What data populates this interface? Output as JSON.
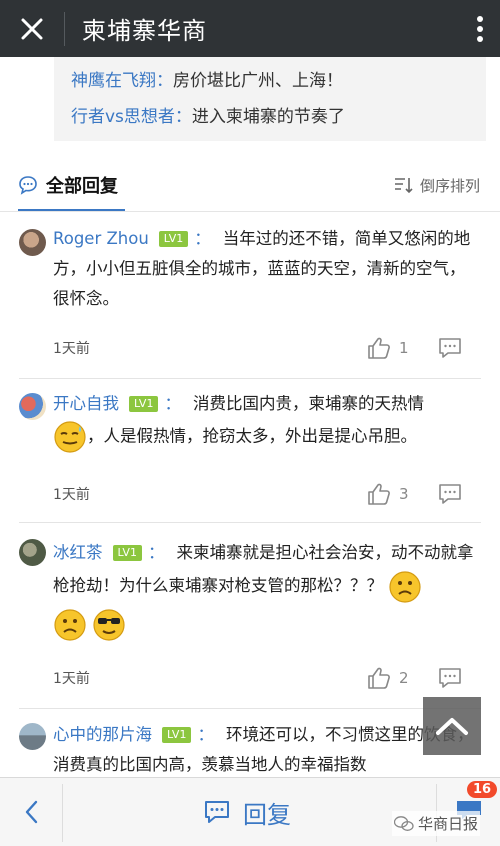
{
  "header": {
    "title": "柬埔寨华商",
    "close_icon": "close-icon",
    "more_icon": "more-vertical-icon"
  },
  "quote": [
    {
      "user": "神鹰在飞翔",
      "sep": "：",
      "text": "房价堪比广州、上海！"
    },
    {
      "user": "行者vs思想者",
      "sep": "：",
      "text": "进入柬埔寨的节奏了"
    }
  ],
  "section": {
    "tab_label": "全部回复",
    "sort_label": "倒序排列"
  },
  "comments": [
    {
      "name": "Roger Zhou",
      "level": "LV1",
      "colon": "：",
      "text": "当年过的还不错，简单又悠闲的地方，小小但五脏俱全的城市，蓝蓝的天空，清新的空气，很怀念。",
      "time": "1天前",
      "likes": "1"
    },
    {
      "name": "开心自我",
      "level": "LV1",
      "colon": "：",
      "text_a": "消费比国内贵，柬埔寨的天热情",
      "text_b": "，人是假热情，抢窃太多，外出是提心吊胆。",
      "time": "1天前",
      "likes": "3"
    },
    {
      "name": "冰红茶",
      "level": "LV1",
      "colon": "：",
      "text": "来柬埔寨就是担心社会治安，动不动就拿枪抢劫！为什么柬埔寨对枪支管的那松？？？",
      "time": "1天前",
      "likes": "2"
    },
    {
      "name": "心中的那片海",
      "level": "LV1",
      "colon": "：",
      "text": "环境还可以，不习惯这里的饮食，消费真的比国内高，羡慕当地人的幸福指数"
    }
  ],
  "bottom": {
    "reply_label": "回复",
    "badge_count": "16",
    "watermark": "华商日报"
  },
  "colors": {
    "accent": "#3b78c4",
    "topbar": "#2f3336",
    "level_badge": "#8cc63f",
    "count_badge": "#f24a2b"
  }
}
